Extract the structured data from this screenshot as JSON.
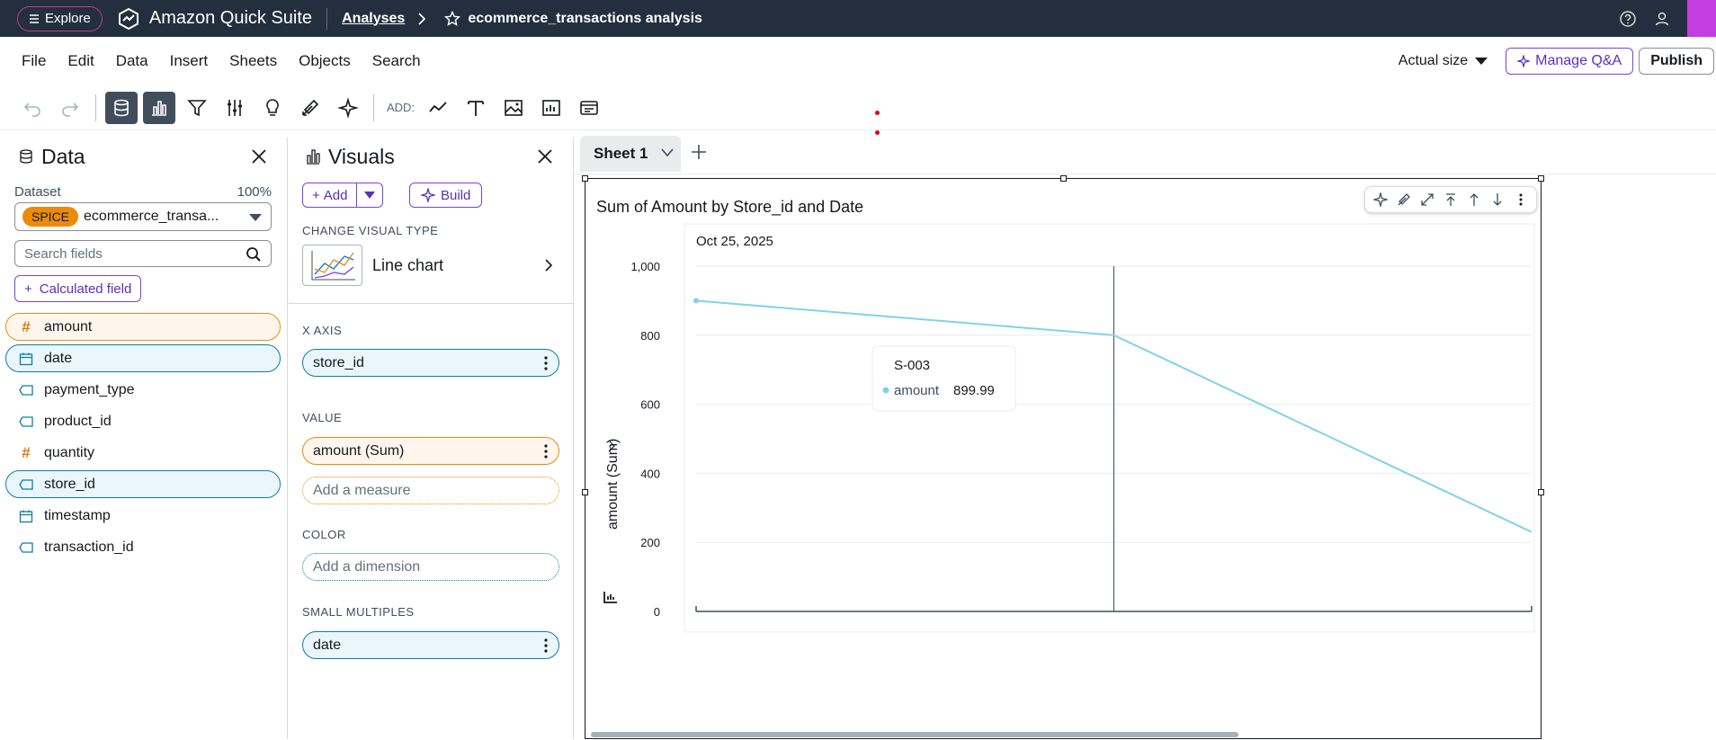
{
  "topbar": {
    "explore_label": "Explore",
    "app_title": "Amazon Quick Suite",
    "breadcrumb_link": "Analyses",
    "analysis_name": "ecommerce_transactions analysis"
  },
  "menubar": {
    "items": [
      "File",
      "Edit",
      "Data",
      "Insert",
      "Sheets",
      "Objects",
      "Search"
    ],
    "zoom": "Actual size",
    "manage_qa": "Manage Q&A",
    "publish": "Publish"
  },
  "toolbar": {
    "add_label": "ADD:",
    "icons": [
      "undo-icon",
      "redo-icon",
      "data-icon",
      "visuals-icon",
      "filter-icon",
      "parameters-icon",
      "insights-icon",
      "themes-icon",
      "ai-sparkle-icon",
      "add-line-chart-icon",
      "add-text-icon",
      "add-image-icon",
      "add-insight-icon",
      "add-embed-icon"
    ]
  },
  "data_panel": {
    "title": "Data",
    "dataset_label": "Dataset",
    "dataset_percent": "100%",
    "spice_badge": "SPICE",
    "dataset_name": "ecommerce_transa...",
    "search_placeholder": "Search fields",
    "calculated_field": "Calculated field",
    "fields": [
      {
        "name": "amount",
        "type": "measure",
        "selected": true
      },
      {
        "name": "date",
        "type": "date",
        "selected": true
      },
      {
        "name": "payment_type",
        "type": "dimension",
        "selected": false
      },
      {
        "name": "product_id",
        "type": "dimension",
        "selected": false
      },
      {
        "name": "quantity",
        "type": "measure",
        "selected": false
      },
      {
        "name": "store_id",
        "type": "dimension",
        "selected": true
      },
      {
        "name": "timestamp",
        "type": "date",
        "selected": false
      },
      {
        "name": "transaction_id",
        "type": "dimension",
        "selected": false
      }
    ]
  },
  "visuals_panel": {
    "title": "Visuals",
    "add_label": "Add",
    "build_label": "Build",
    "change_type_label": "CHANGE VISUAL TYPE",
    "visual_type": "Line chart",
    "x_axis_label": "X AXIS",
    "x_axis_field": "store_id",
    "value_label": "VALUE",
    "value_field": "amount (Sum)",
    "add_measure": "Add a measure",
    "color_label": "COLOR",
    "add_dimension": "Add a dimension",
    "small_multiples_label": "SMALL MULTIPLES",
    "small_multiples_field": "date"
  },
  "canvas": {
    "sheet_tab": "Sheet 1",
    "visual_title": "Sum of Amount by Store_id and Date",
    "panel_title": "Oct 25, 2025",
    "y_axis_label": "amount (Sum)",
    "tooltip": {
      "category": "S-003",
      "series": "amount",
      "value": "899.99"
    }
  },
  "chart_data": {
    "type": "line",
    "title": "Sum of Amount by Store_id and Date",
    "subtitle": "Oct 25, 2025",
    "ylabel": "amount (Sum)",
    "xlabel": "",
    "ylim": [
      0,
      1000
    ],
    "yticks": [
      "1,000",
      "800",
      "600",
      "400",
      "200",
      "0"
    ],
    "ytick_values": [
      1000,
      800,
      600,
      400,
      200,
      0
    ],
    "x": [
      0,
      1,
      2
    ],
    "series": [
      {
        "name": "amount",
        "values": [
          900,
          800,
          230
        ],
        "color": "#7fd3e8"
      }
    ],
    "grid": true,
    "highlighted_index": 1
  },
  "colors": {
    "topbar": "#232f3e",
    "accent_purple": "#7645d8",
    "measure_orange": "#ec8b0a",
    "dimension_blue": "#0a7ea6",
    "line_series": "#7fd3e8"
  }
}
